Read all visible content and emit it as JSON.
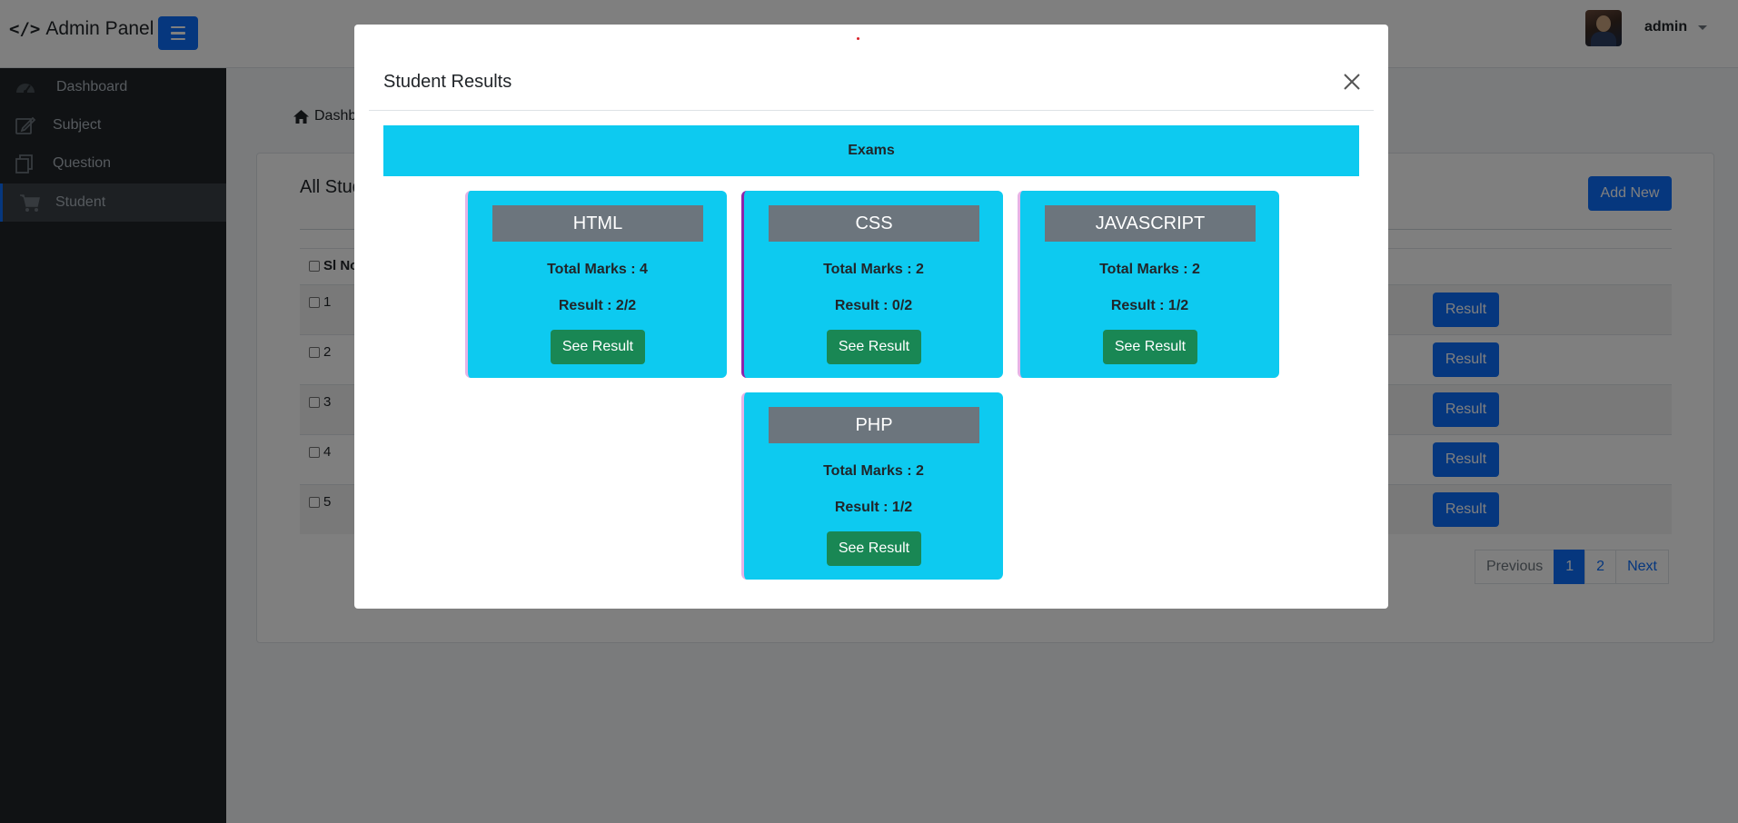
{
  "topbar": {
    "brand_icon": "</>",
    "brand": "Admin Panel",
    "user": "admin"
  },
  "sidebar": {
    "items": [
      {
        "label": "Dashboard",
        "icon": "gauge-icon"
      },
      {
        "label": "Subject",
        "icon": "edit-icon"
      },
      {
        "label": "Question",
        "icon": "copy-icon"
      },
      {
        "label": "Student",
        "icon": "cart-icon",
        "active": true
      }
    ]
  },
  "main": {
    "breadcrumb": "Dashboard",
    "card_title": "All Students",
    "add_new": "Add New",
    "table": {
      "header": "Sl No",
      "rows": [
        "1",
        "2",
        "3",
        "4",
        "5"
      ],
      "result_label": "Result"
    },
    "pagination": {
      "previous": "Previous",
      "pages": [
        "1",
        "2"
      ],
      "active_page": "1",
      "next": "Next"
    }
  },
  "modal": {
    "title": "Student Results",
    "section": "Exams",
    "exams": [
      {
        "name": "HTML",
        "total": "Total Marks : 4",
        "result": "Result : 2/2",
        "button": "See Result",
        "accent": "#e6b3e6"
      },
      {
        "name": "CSS",
        "total": "Total Marks : 2",
        "result": "Result : 0/2",
        "button": "See Result",
        "accent": "#8e24aa"
      },
      {
        "name": "JAVASCRIPT",
        "total": "Total Marks : 2",
        "result": "Result : 1/2",
        "button": "See Result",
        "accent": "#e6b3e6"
      },
      {
        "name": "PHP",
        "total": "Total Marks : 2",
        "result": "Result : 1/2",
        "button": "See Result",
        "accent": "#e6b3e6"
      }
    ]
  },
  "colors": {
    "primary": "#0d6efd",
    "info": "#0dcaf0",
    "success": "#198754",
    "secondary": "#6c757d",
    "sidebar": "#212529"
  }
}
